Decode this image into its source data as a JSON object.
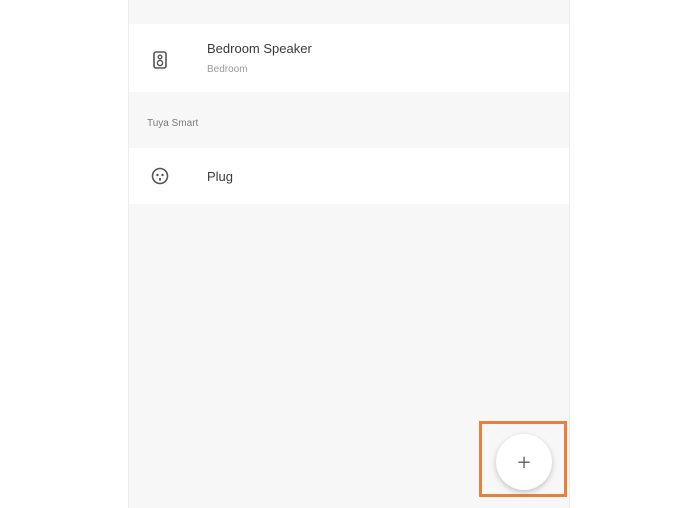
{
  "devices_group_1": {
    "speaker": {
      "title": "Bedroom  Speaker",
      "room": "Bedroom",
      "icon": "speaker-icon"
    }
  },
  "section": {
    "title": "Tuya Smart"
  },
  "devices_group_2": {
    "plug": {
      "title": "Plug",
      "icon": "plug-icon"
    }
  },
  "fab": {
    "label": "+",
    "icon": "add-icon"
  },
  "colors": {
    "highlight": "#e8803a",
    "panel_background": "#f7f7f7",
    "row_background": "#ffffff"
  }
}
